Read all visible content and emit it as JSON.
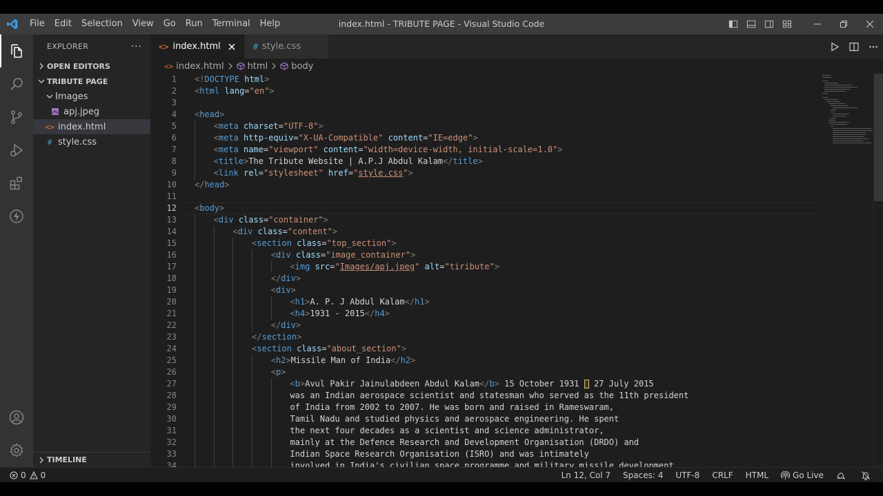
{
  "window": {
    "title": "index.html - TRIBUTE PAGE - Visual Studio Code",
    "menus": [
      "File",
      "Edit",
      "Selection",
      "View",
      "Go",
      "Run",
      "Terminal",
      "Help"
    ]
  },
  "sidebar": {
    "title": "EXPLORER",
    "more": "···",
    "open_editors": "OPEN EDITORS",
    "project": "TRIBUTE PAGE",
    "tree": [
      {
        "label": "Images",
        "kind": "folder"
      },
      {
        "label": "apj.jpeg",
        "kind": "image"
      },
      {
        "label": "index.html",
        "kind": "html",
        "selected": true
      },
      {
        "label": "style.css",
        "kind": "css"
      }
    ],
    "timeline": "TIMELINE"
  },
  "tabs": [
    {
      "label": "index.html",
      "icon": "<>",
      "active": true
    },
    {
      "label": "style.css",
      "icon": "#",
      "active": false
    }
  ],
  "breadcrumbs": {
    "file": "index.html",
    "html": "html",
    "body": "body"
  },
  "code": {
    "current_line": 12,
    "lines": [
      {
        "n": "1",
        "indent": 0,
        "tokens": [
          [
            "br",
            "<!"
          ],
          [
            "tag",
            "DOCTYPE"
          ],
          [
            "txt",
            " "
          ],
          [
            "attr",
            "html"
          ],
          [
            "br",
            ">"
          ]
        ]
      },
      {
        "n": "2",
        "indent": 0,
        "tokens": [
          [
            "br",
            "<"
          ],
          [
            "tag",
            "html"
          ],
          [
            "txt",
            " "
          ],
          [
            "attr",
            "lang"
          ],
          [
            "txt",
            "="
          ],
          [
            "str",
            "\"en\""
          ],
          [
            "br",
            ">"
          ]
        ]
      },
      {
        "n": "3",
        "indent": 0,
        "tokens": []
      },
      {
        "n": "4",
        "indent": 0,
        "tokens": [
          [
            "br",
            "<"
          ],
          [
            "tag",
            "head"
          ],
          [
            "br",
            ">"
          ]
        ]
      },
      {
        "n": "5",
        "indent": 1,
        "tokens": [
          [
            "br",
            "<"
          ],
          [
            "tag",
            "meta"
          ],
          [
            "txt",
            " "
          ],
          [
            "attr",
            "charset"
          ],
          [
            "txt",
            "="
          ],
          [
            "str",
            "\"UTF-8\""
          ],
          [
            "br",
            ">"
          ]
        ]
      },
      {
        "n": "6",
        "indent": 1,
        "tokens": [
          [
            "br",
            "<"
          ],
          [
            "tag",
            "meta"
          ],
          [
            "txt",
            " "
          ],
          [
            "attr",
            "http-equiv"
          ],
          [
            "txt",
            "="
          ],
          [
            "str",
            "\"X-UA-Compatible\""
          ],
          [
            "txt",
            " "
          ],
          [
            "attr",
            "content"
          ],
          [
            "txt",
            "="
          ],
          [
            "str",
            "\"IE=edge\""
          ],
          [
            "br",
            ">"
          ]
        ]
      },
      {
        "n": "7",
        "indent": 1,
        "tokens": [
          [
            "br",
            "<"
          ],
          [
            "tag",
            "meta"
          ],
          [
            "txt",
            " "
          ],
          [
            "attr",
            "name"
          ],
          [
            "txt",
            "="
          ],
          [
            "str",
            "\"viewport\""
          ],
          [
            "txt",
            " "
          ],
          [
            "attr",
            "content"
          ],
          [
            "txt",
            "="
          ],
          [
            "str",
            "\"width=device-width, initial-scale=1.0\""
          ],
          [
            "br",
            ">"
          ]
        ]
      },
      {
        "n": "8",
        "indent": 1,
        "tokens": [
          [
            "br",
            "<"
          ],
          [
            "tag",
            "title"
          ],
          [
            "br",
            ">"
          ],
          [
            "txt",
            "The Tribute Website | A.P.J Abdul Kalam"
          ],
          [
            "br",
            "</"
          ],
          [
            "tag",
            "title"
          ],
          [
            "br",
            ">"
          ]
        ]
      },
      {
        "n": "9",
        "indent": 1,
        "tokens": [
          [
            "br",
            "<"
          ],
          [
            "tag",
            "link"
          ],
          [
            "txt",
            " "
          ],
          [
            "attr",
            "rel"
          ],
          [
            "txt",
            "="
          ],
          [
            "str",
            "\"stylesheet\""
          ],
          [
            "txt",
            " "
          ],
          [
            "attr",
            "href"
          ],
          [
            "txt",
            "="
          ],
          [
            "str",
            "\""
          ],
          [
            "link",
            "style.css"
          ],
          [
            "str",
            "\""
          ],
          [
            "br",
            ">"
          ]
        ]
      },
      {
        "n": "10",
        "indent": 0,
        "tokens": [
          [
            "br",
            "</"
          ],
          [
            "tag",
            "head"
          ],
          [
            "br",
            ">"
          ]
        ]
      },
      {
        "n": "11",
        "indent": 0,
        "tokens": []
      },
      {
        "n": "12",
        "indent": 0,
        "tokens": [
          [
            "br",
            "<"
          ],
          [
            "tag",
            "body"
          ],
          [
            "br",
            ">"
          ]
        ]
      },
      {
        "n": "13",
        "indent": 1,
        "tokens": [
          [
            "br",
            "<"
          ],
          [
            "tag",
            "div"
          ],
          [
            "txt",
            " "
          ],
          [
            "attr",
            "class"
          ],
          [
            "txt",
            "="
          ],
          [
            "str",
            "\"container\""
          ],
          [
            "br",
            ">"
          ]
        ]
      },
      {
        "n": "14",
        "indent": 2,
        "tokens": [
          [
            "br",
            "<"
          ],
          [
            "tag",
            "div"
          ],
          [
            "txt",
            " "
          ],
          [
            "attr",
            "class"
          ],
          [
            "txt",
            "="
          ],
          [
            "str",
            "\"content\""
          ],
          [
            "br",
            ">"
          ]
        ]
      },
      {
        "n": "15",
        "indent": 3,
        "tokens": [
          [
            "br",
            "<"
          ],
          [
            "tag",
            "section"
          ],
          [
            "txt",
            " "
          ],
          [
            "attr",
            "class"
          ],
          [
            "txt",
            "="
          ],
          [
            "str",
            "\"top_section\""
          ],
          [
            "br",
            ">"
          ]
        ]
      },
      {
        "n": "16",
        "indent": 4,
        "tokens": [
          [
            "br",
            "<"
          ],
          [
            "tag",
            "div"
          ],
          [
            "txt",
            " "
          ],
          [
            "attr",
            "class"
          ],
          [
            "txt",
            "="
          ],
          [
            "str",
            "\"image_container\""
          ],
          [
            "br",
            ">"
          ]
        ]
      },
      {
        "n": "17",
        "indent": 5,
        "tokens": [
          [
            "br",
            "<"
          ],
          [
            "tag",
            "img"
          ],
          [
            "txt",
            " "
          ],
          [
            "attr",
            "src"
          ],
          [
            "txt",
            "="
          ],
          [
            "str",
            "\""
          ],
          [
            "link",
            "Images/apj.jpeg"
          ],
          [
            "str",
            "\""
          ],
          [
            "txt",
            " "
          ],
          [
            "attr",
            "alt"
          ],
          [
            "txt",
            "="
          ],
          [
            "str",
            "\"tiribute\""
          ],
          [
            "br",
            ">"
          ]
        ]
      },
      {
        "n": "18",
        "indent": 4,
        "tokens": [
          [
            "br",
            "</"
          ],
          [
            "tag",
            "div"
          ],
          [
            "br",
            ">"
          ]
        ]
      },
      {
        "n": "19",
        "indent": 4,
        "tokens": [
          [
            "br",
            "<"
          ],
          [
            "tag",
            "div"
          ],
          [
            "br",
            ">"
          ]
        ]
      },
      {
        "n": "20",
        "indent": 5,
        "tokens": [
          [
            "br",
            "<"
          ],
          [
            "tag",
            "h1"
          ],
          [
            "br",
            ">"
          ],
          [
            "txt",
            "A. P. J Abdul Kalam"
          ],
          [
            "br",
            "</"
          ],
          [
            "tag",
            "h1"
          ],
          [
            "br",
            ">"
          ]
        ]
      },
      {
        "n": "21",
        "indent": 5,
        "tokens": [
          [
            "br",
            "<"
          ],
          [
            "tag",
            "h4"
          ],
          [
            "br",
            ">"
          ],
          [
            "txt",
            "1931 - 2015"
          ],
          [
            "br",
            "</"
          ],
          [
            "tag",
            "h4"
          ],
          [
            "br",
            ">"
          ]
        ]
      },
      {
        "n": "22",
        "indent": 4,
        "tokens": [
          [
            "br",
            "</"
          ],
          [
            "tag",
            "div"
          ],
          [
            "br",
            ">"
          ]
        ]
      },
      {
        "n": "23",
        "indent": 3,
        "tokens": [
          [
            "br",
            "</"
          ],
          [
            "tag",
            "section"
          ],
          [
            "br",
            ">"
          ]
        ]
      },
      {
        "n": "24",
        "indent": 3,
        "tokens": [
          [
            "br",
            "<"
          ],
          [
            "tag",
            "section"
          ],
          [
            "txt",
            " "
          ],
          [
            "attr",
            "class"
          ],
          [
            "txt",
            "="
          ],
          [
            "str",
            "\"about_section\""
          ],
          [
            "br",
            ">"
          ]
        ]
      },
      {
        "n": "25",
        "indent": 4,
        "tokens": [
          [
            "br",
            "<"
          ],
          [
            "tag",
            "h2"
          ],
          [
            "br",
            ">"
          ],
          [
            "txt",
            "Missile Man of India"
          ],
          [
            "br",
            "</"
          ],
          [
            "tag",
            "h2"
          ],
          [
            "br",
            ">"
          ]
        ]
      },
      {
        "n": "26",
        "indent": 4,
        "tokens": [
          [
            "br",
            "<"
          ],
          [
            "tag",
            "p"
          ],
          [
            "br",
            ">"
          ]
        ]
      },
      {
        "n": "27",
        "indent": 5,
        "tokens": [
          [
            "br",
            "<"
          ],
          [
            "tag",
            "b"
          ],
          [
            "br",
            ">"
          ],
          [
            "txt",
            "Avul Pakir Jainulabdeen Abdul Kalam"
          ],
          [
            "br",
            "</"
          ],
          [
            "tag",
            "b"
          ],
          [
            "br",
            ">"
          ],
          [
            "txt",
            " 15 October 1931 "
          ],
          [
            "box",
            ""
          ],
          [
            "txt",
            " 27 July 2015"
          ]
        ]
      },
      {
        "n": "28",
        "indent": 5,
        "tokens": [
          [
            "txt",
            "was an Indian aerospace scientist and statesman who served as the 11th president"
          ]
        ]
      },
      {
        "n": "29",
        "indent": 5,
        "tokens": [
          [
            "txt",
            "of India from 2002 to 2007. He was born and raised in Rameswaram,"
          ]
        ]
      },
      {
        "n": "30",
        "indent": 5,
        "tokens": [
          [
            "txt",
            "Tamil Nadu and studied physics and aerospace engineering. He spent"
          ]
        ]
      },
      {
        "n": "31",
        "indent": 5,
        "tokens": [
          [
            "txt",
            "the next four decades as a scientist and science administrator,"
          ]
        ]
      },
      {
        "n": "32",
        "indent": 5,
        "tokens": [
          [
            "txt",
            "mainly at the Defence Research and Development Organisation (DRDO) and"
          ]
        ]
      },
      {
        "n": "33",
        "indent": 5,
        "tokens": [
          [
            "txt",
            "Indian Space Research Organisation (ISRO) and was intimately"
          ]
        ]
      },
      {
        "n": "34",
        "indent": 5,
        "tokens": [
          [
            "txt",
            "involved in India's civilian space programme and military missile development"
          ]
        ]
      }
    ]
  },
  "status": {
    "errors": "0",
    "warnings": "0",
    "position": "Ln 12, Col 7",
    "spaces": "Spaces: 4",
    "encoding": "UTF-8",
    "eol": "CRLF",
    "language": "HTML",
    "golive": "Go Live"
  },
  "colors": {
    "accent": "#007acc",
    "tag": "#569cd6",
    "attr": "#9cdcfe",
    "string": "#ce9178"
  }
}
